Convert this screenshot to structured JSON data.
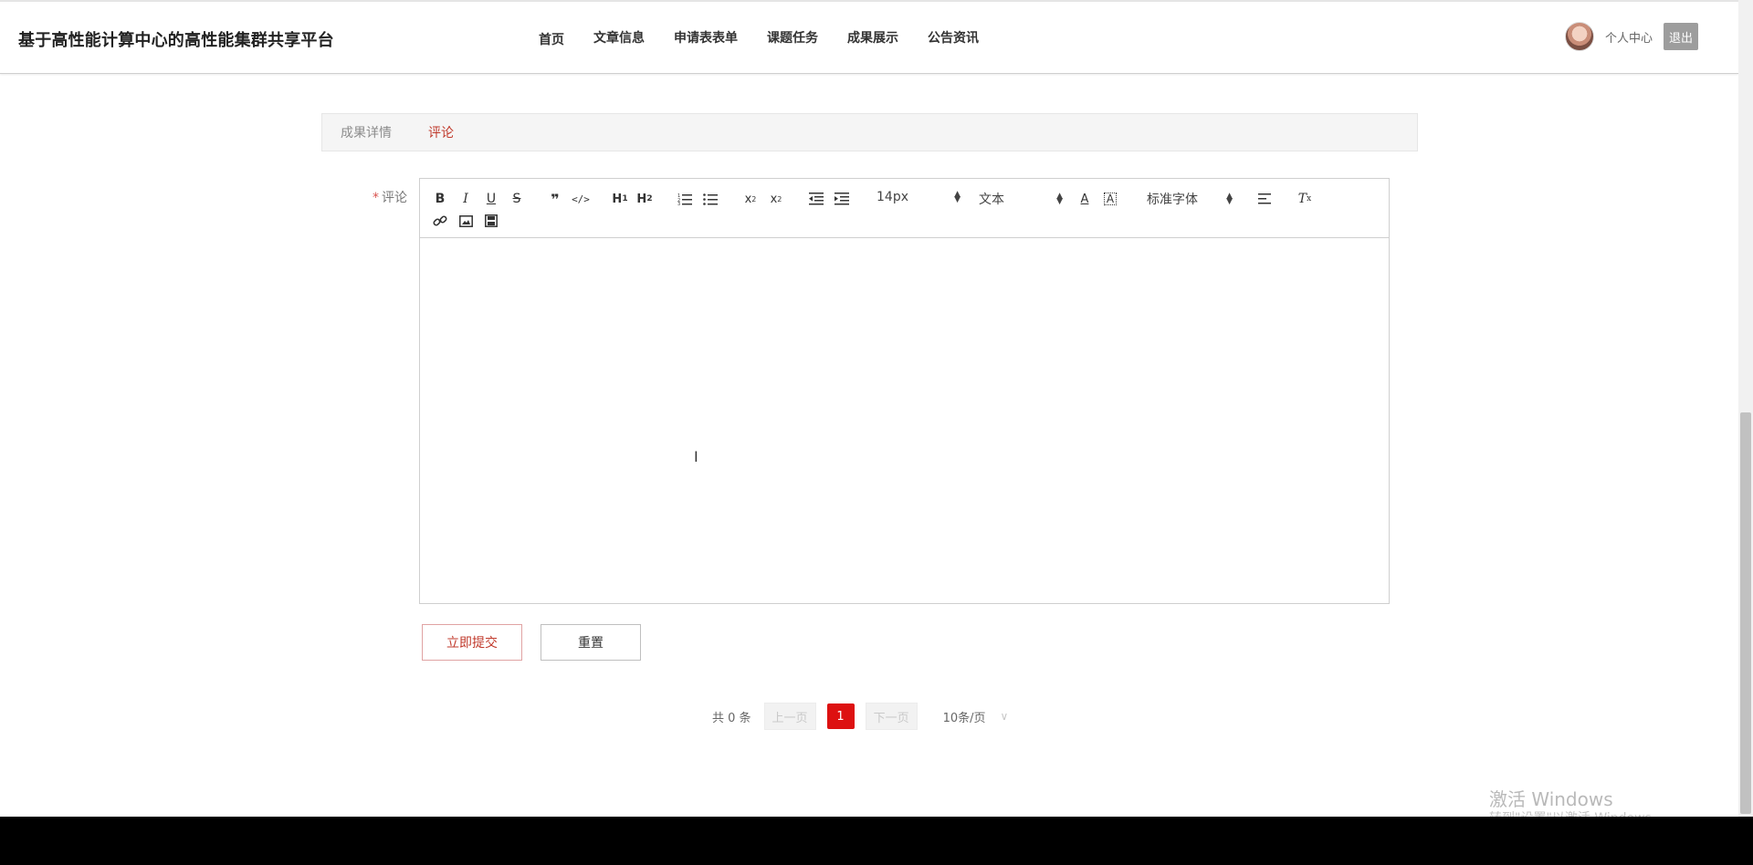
{
  "header": {
    "site_title": "基于高性能计算中心的高性能集群共享平台",
    "nav": [
      "首页",
      "文章信息",
      "申请表表单",
      "课题任务",
      "成果展示",
      "公告资讯"
    ],
    "user_center": "个人中心",
    "logout": "退出"
  },
  "tabs": [
    {
      "label": "成果详情",
      "active": false
    },
    {
      "label": "评论",
      "active": true
    }
  ],
  "form": {
    "required_mark": "*",
    "comment_label": "评论",
    "editor": {
      "font_size": "14px",
      "header_picker": "文本",
      "font_family": "标准字体",
      "toolbar_icons": [
        "bold-icon",
        "italic-icon",
        "underline-icon",
        "strike-icon",
        "blockquote-icon",
        "code-block-icon",
        "header1-icon",
        "header2-icon",
        "ordered-list-icon",
        "bullet-list-icon",
        "subscript-icon",
        "superscript-icon",
        "outdent-icon",
        "indent-icon",
        "font-color-icon",
        "background-color-icon",
        "align-icon",
        "clear-format-icon",
        "link-icon",
        "image-icon",
        "video-icon"
      ],
      "content": ""
    },
    "submit": "立即提交",
    "reset": "重置"
  },
  "pagination": {
    "total": "共 0 条",
    "prev": "上一页",
    "current": "1",
    "next": "下一页",
    "page_size": "10条/页"
  },
  "watermark": {
    "line1": "激活 Windows",
    "line2": "转到\"设置\"以激活 Windows。"
  },
  "colors": {
    "accent": "#cc1111",
    "active_tab": "#c0392b",
    "logout_bg": "#9d9d9d"
  }
}
